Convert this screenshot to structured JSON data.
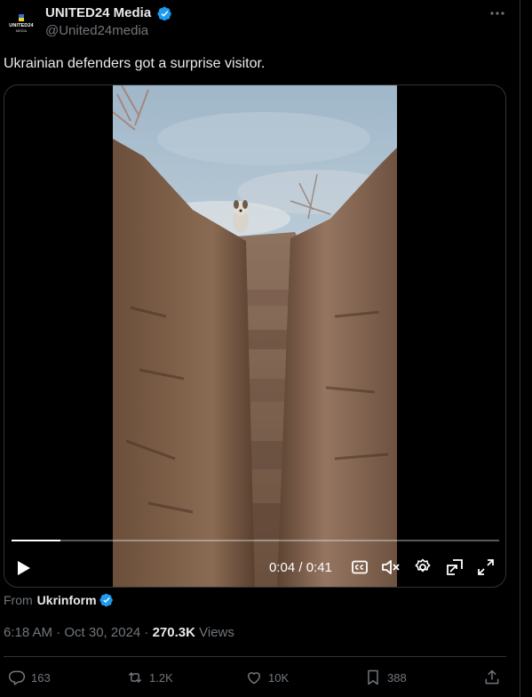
{
  "author": {
    "name": "UNITED24 Media",
    "handle": "@United24media",
    "avatar_wordmark": "UNITED24",
    "avatar_sub": "MEDIA"
  },
  "tweet": {
    "text": "Ukrainian defenders got a surprise visitor."
  },
  "video": {
    "time": "0:04 / 0:41",
    "progress": 0.1
  },
  "source": {
    "prefix": "From",
    "name": "Ukrinform"
  },
  "meta": {
    "timestamp": "6:18 AM · Oct 30, 2024 · ",
    "views_count": "270.3K",
    "views_label": " Views"
  },
  "actions": {
    "replies": "163",
    "reposts": "1.2K",
    "likes": "10K",
    "bookmarks": "388"
  },
  "colors": {
    "background": "#000000",
    "text_primary": "#e7e9ea",
    "text_secondary": "#71767b",
    "border": "#2f3336",
    "verified": "#1d9bf0"
  },
  "icons": [
    "verified-badge-icon",
    "more-icon",
    "play-icon",
    "closed-captions-icon",
    "volume-muted-icon",
    "settings-icon",
    "picture-in-picture-icon",
    "fullscreen-icon",
    "reply-icon",
    "repost-icon",
    "like-icon",
    "bookmark-icon",
    "share-icon"
  ]
}
